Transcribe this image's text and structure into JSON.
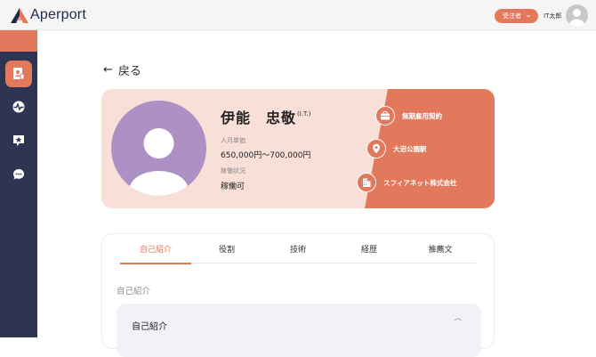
{
  "header": {
    "app_name": "Aperport",
    "role_label": "受注者",
    "username": "IT太郎"
  },
  "sidebar": {
    "items": [
      {
        "icon": "profile-document-icon",
        "active": true
      },
      {
        "icon": "pulse-icon",
        "active": false
      },
      {
        "icon": "starred-message-icon",
        "active": false
      },
      {
        "icon": "chat-bubble-icon",
        "active": false
      }
    ]
  },
  "back_label": "戻る",
  "profile": {
    "name": "伊能　忠敬",
    "initials": "(I.T.)",
    "rate_label": "人月単価",
    "rate_value": "650,000円〜700,000円",
    "status_label": "稼働状況",
    "status_value": "稼働可",
    "contract_type": "無期雇用契約",
    "station": "大沼公園駅",
    "company": "スフィアネット株式会社"
  },
  "tabs": [
    "自己紹介",
    "役割",
    "技術",
    "経歴",
    "推薦文"
  ],
  "active_tab": "自己紹介",
  "section_title": "自己紹介",
  "accordion_title": "自己紹介",
  "colors": {
    "accent": "#e2785c",
    "sidebar": "#2e3552",
    "card_bg": "#f8dfd8",
    "avatar": "#ad91c4"
  }
}
